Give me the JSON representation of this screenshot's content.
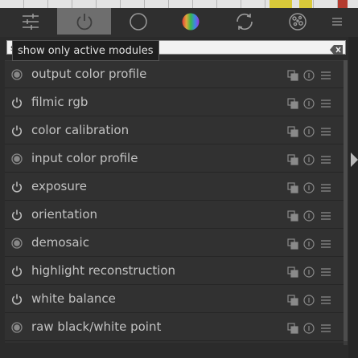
{
  "tabs": [
    {
      "icon": "sliders-icon"
    },
    {
      "icon": "power-icon"
    },
    {
      "icon": "circle-icon"
    },
    {
      "icon": "color-wheel-icon"
    },
    {
      "icon": "refresh-icon"
    },
    {
      "icon": "texture-icon"
    },
    {
      "icon": "menu-icon"
    }
  ],
  "search": {
    "value": "s",
    "clear_icon": "backspace-icon"
  },
  "tooltip": "show only active modules",
  "modules": [
    {
      "label": "output color profile",
      "status": "always-on"
    },
    {
      "label": "filmic rgb",
      "status": "power"
    },
    {
      "label": "color calibration",
      "status": "power"
    },
    {
      "label": "input color profile",
      "status": "always-on"
    },
    {
      "label": "exposure",
      "status": "power"
    },
    {
      "label": "orientation",
      "status": "power"
    },
    {
      "label": "demosaic",
      "status": "always-on"
    },
    {
      "label": "highlight reconstruction",
      "status": "power"
    },
    {
      "label": "white balance",
      "status": "power"
    },
    {
      "label": "raw black/white point",
      "status": "always-on"
    }
  ],
  "row_actions": [
    "multi-instance-icon",
    "reset-icon",
    "presets-icon"
  ],
  "colors": {
    "background": "#2b2b2b",
    "active_tab": "#6e6e6e",
    "text": "#c2c2c2"
  }
}
